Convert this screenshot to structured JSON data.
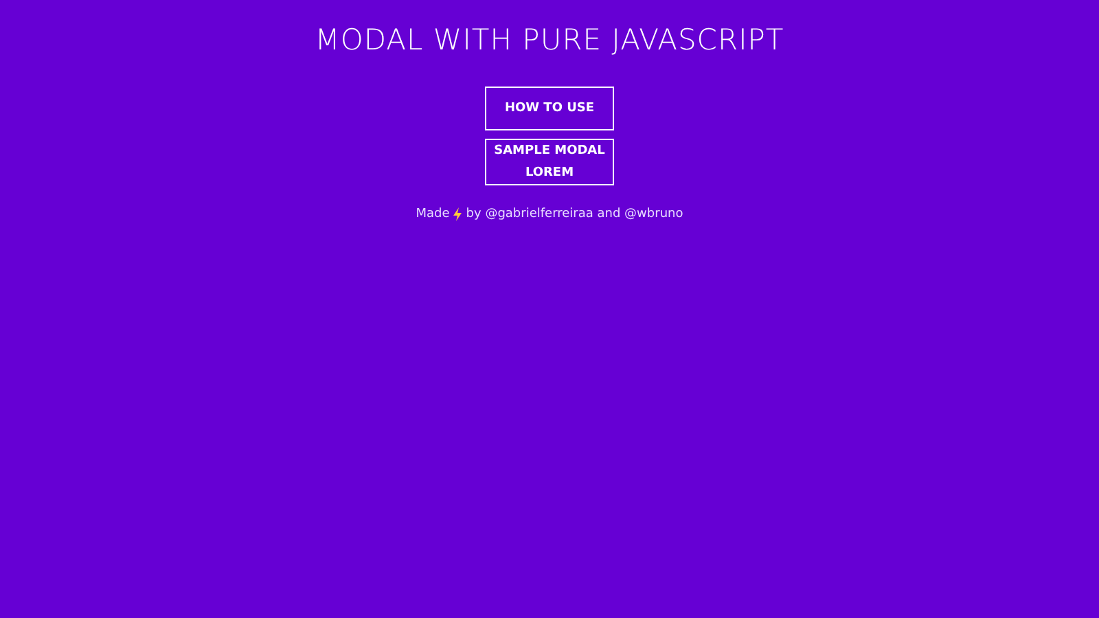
{
  "title": "MODAL WITH PURE JAVASCRIPT",
  "buttons": [
    "HOW TO USE",
    "SAMPLE MODAL LOREM"
  ],
  "footer": {
    "lead": "Made",
    "by": "by",
    "joiner": "and",
    "links": [
      "@gabrielferreiraa",
      "@wbruno"
    ]
  }
}
